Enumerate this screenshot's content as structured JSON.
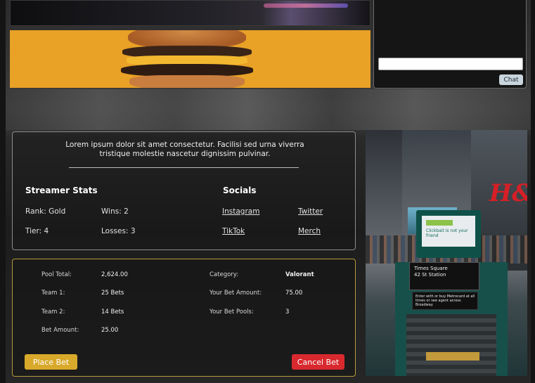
{
  "chat": {
    "input_value": "",
    "button_label": "Chat"
  },
  "streamer": {
    "description": "Lorem ipsum dolor sit amet consectetur. Facilisi sed urna viverra tristique molestie nascetur dignissim pulvinar.",
    "stats_title": "Streamer Stats",
    "rank": "Rank: Gold",
    "wins": "Wins: 2",
    "tier": "Tier: 4",
    "losses": "Losses: 3"
  },
  "socials": {
    "title": "Socials",
    "links": [
      "Instagram",
      "Twitter",
      "TikTok",
      "Merch"
    ]
  },
  "bet": {
    "pool_total_label": "Pool Total:",
    "pool_total_value": "2,624.00",
    "team1_label": "Team 1:",
    "team1_value": "25 Bets",
    "team2_label": "Team 2:",
    "team2_value": "14 Bets",
    "bet_amount_label": "Bet Amount:",
    "bet_amount_value": "25.00",
    "category_label": "Category:",
    "category_value": "Valorant",
    "your_bet_amount_label": "Your Bet Amount:",
    "your_bet_amount_value": "75.00",
    "your_bet_pools_label": "Your Bet Pools:",
    "your_bet_pools_value": "3",
    "place_label": "Place Bet",
    "cancel_label": "Cancel Bet"
  },
  "photo": {
    "brand_sign": "H&M",
    "station_line1": "Times Square",
    "station_line2": "42 St Station",
    "kiosk_text": "Clickbait is not your friend",
    "notice_text": "Enter with or buy Metrocard at all times or see agent across Broadway"
  },
  "colors": {
    "place_button": "#d9a92b",
    "cancel_button": "#d8292e",
    "bet_border": "#b89a3c",
    "banner": "#e9a126"
  }
}
